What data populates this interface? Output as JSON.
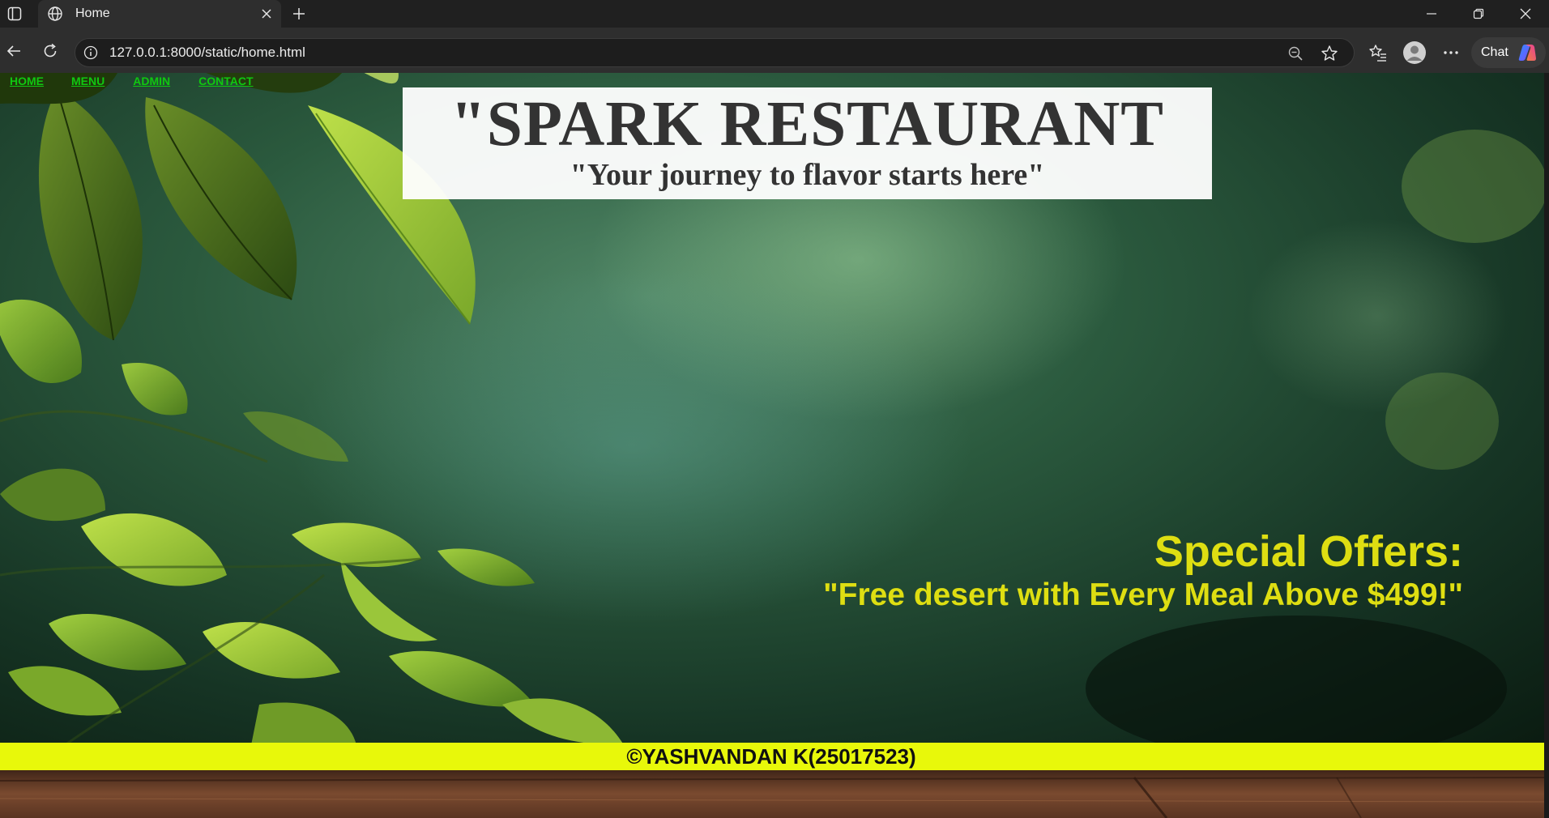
{
  "browser": {
    "tab_title": "Home",
    "url": "127.0.0.1:8000/static/home.html",
    "chat_label": "Chat"
  },
  "nav": {
    "items": [
      "HOME",
      "MENU",
      "ADMIN",
      "CONTACT"
    ]
  },
  "hero": {
    "title": "\"SPARK RESTAURANT",
    "tagline": "\"Your journey to flavor starts here\""
  },
  "offers": {
    "heading": "Special Offers:",
    "text": "\"Free desert with Every Meal Above $499!\""
  },
  "footer": {
    "text": "©YASHVANDAN K(25017523)"
  },
  "colors": {
    "nav_link": "#10c810",
    "offer_text": "#dede12",
    "footer_bg": "#e8f80a",
    "hero_text": "#333333"
  }
}
